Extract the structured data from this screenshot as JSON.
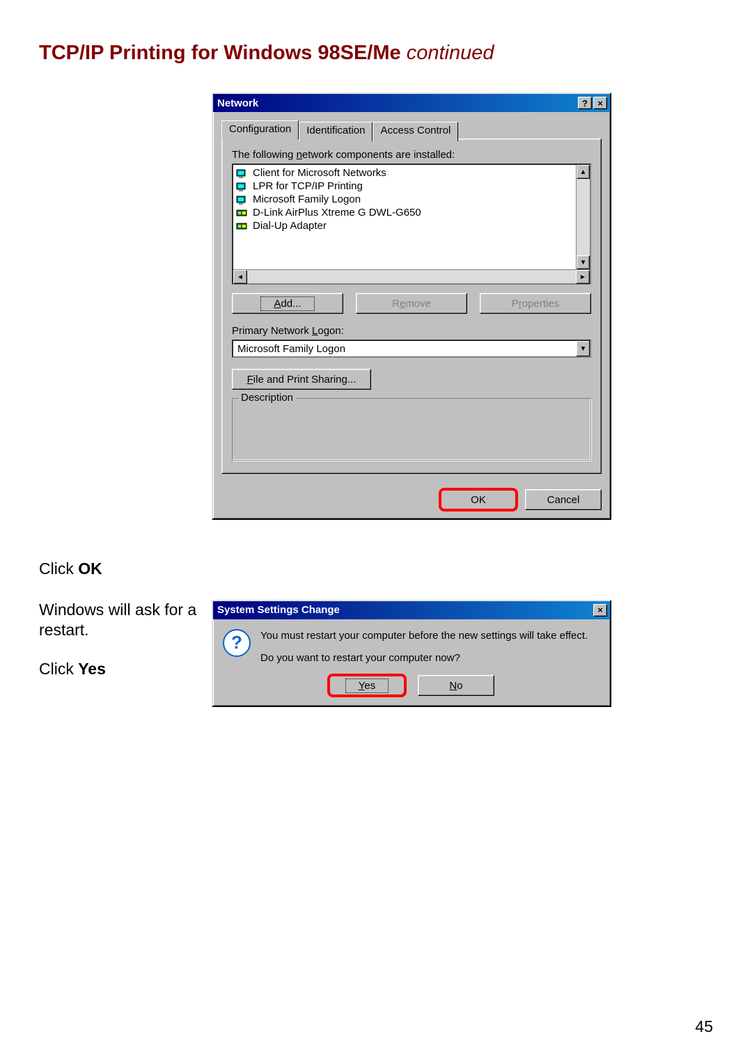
{
  "page": {
    "heading_main": "TCP/IP Printing for Windows 98SE/Me ",
    "heading_cont": "continued",
    "number": "45"
  },
  "side": {
    "click_ok_pre": "Click ",
    "click_ok_bold": "OK",
    "restart_line": "Windows will ask for a restart.",
    "click_yes_pre": "Click ",
    "click_yes_bold": "Yes"
  },
  "win1": {
    "title": "Network",
    "help_glyph": "?",
    "close_glyph": "×",
    "tabs": {
      "t0": "Configuration",
      "t1": "Identification",
      "t2": "Access Control"
    },
    "installed_label_pre": "The following ",
    "installed_label_u": "n",
    "installed_label_post": "etwork components are installed:",
    "components": [
      "Client for Microsoft Networks",
      "LPR for TCP/IP Printing",
      "Microsoft Family Logon",
      "D-Link AirPlus Xtreme G DWL-G650",
      "Dial-Up Adapter"
    ],
    "btn_add_u": "A",
    "btn_add_rest": "dd...",
    "btn_remove_pre": "R",
    "btn_remove_u": "e",
    "btn_remove_post": "move",
    "btn_props_pre": "P",
    "btn_props_u": "r",
    "btn_props_post": "operties",
    "primary_label_pre": "Primary Network ",
    "primary_label_u": "L",
    "primary_label_post": "ogon:",
    "primary_value": "Microsoft Family Logon",
    "fps_btn_u": "F",
    "fps_btn_rest": "ile and Print Sharing...",
    "desc_title": "Description",
    "ok": "OK",
    "cancel": "Cancel"
  },
  "win2": {
    "title": "System Settings Change",
    "close_glyph": "×",
    "msg1": "You must restart your computer before the new settings will take effect.",
    "msg2": "Do you want to restart your computer now?",
    "yes_u": "Y",
    "yes_rest": "es",
    "no_u": "N",
    "no_rest": "o"
  }
}
